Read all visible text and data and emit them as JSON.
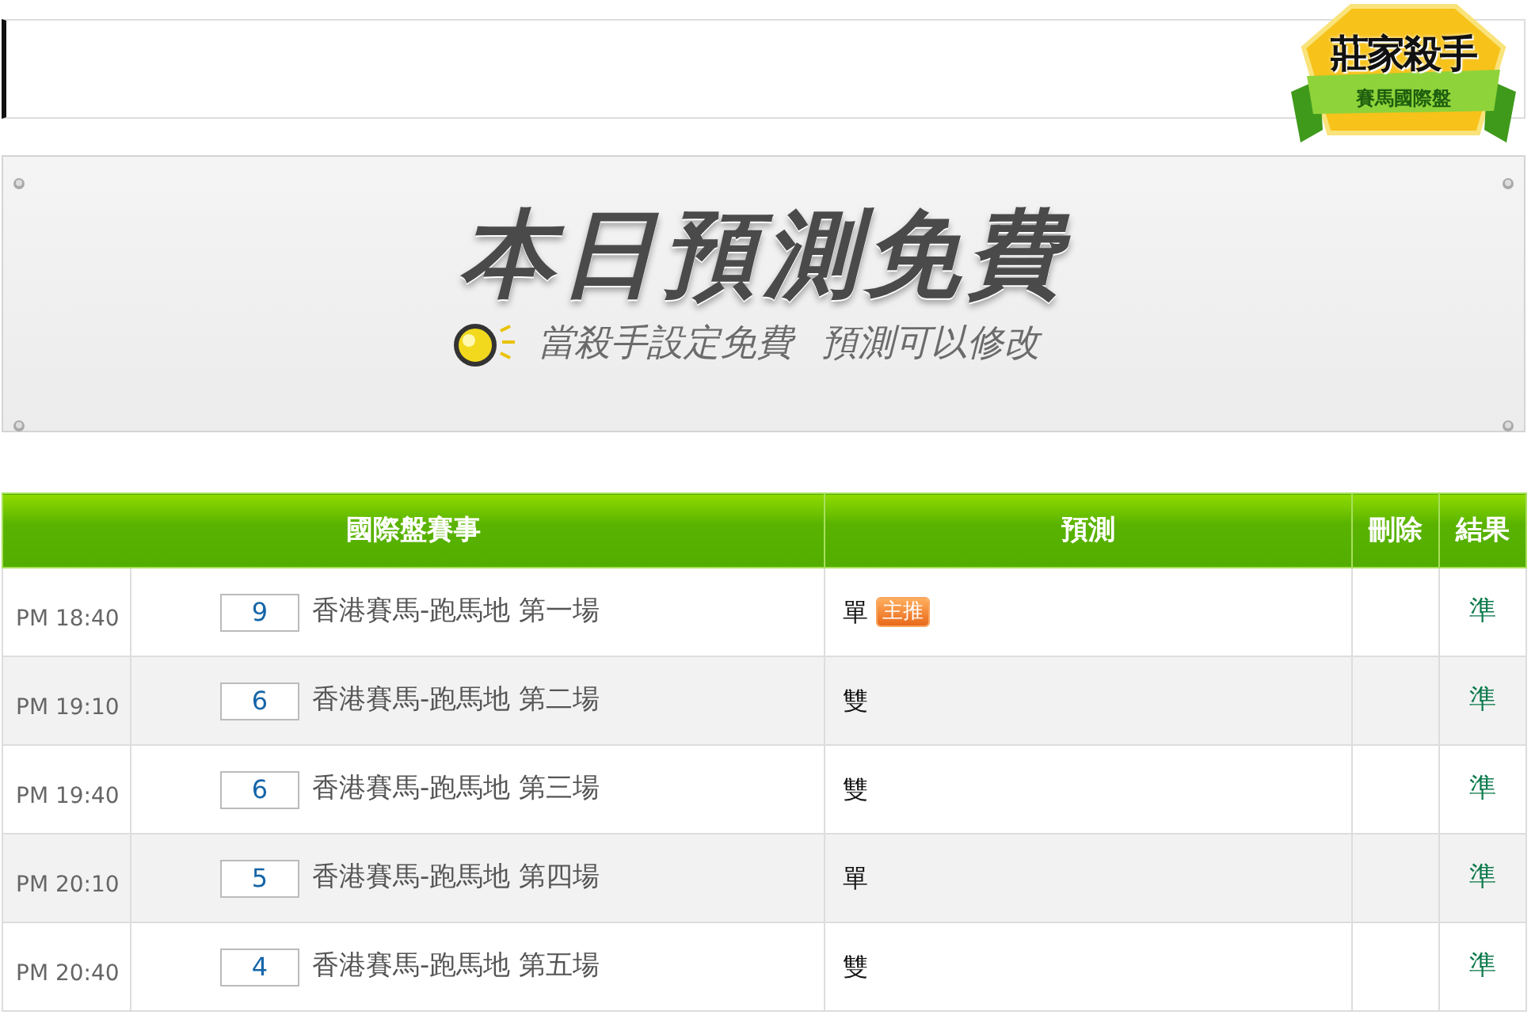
{
  "logo": {
    "title": "莊家殺手",
    "subtitle": "賽馬國際盤"
  },
  "banner": {
    "headline": "本日預測免費",
    "tagline": [
      "當殺手設定免費",
      "預測可以修改"
    ]
  },
  "table": {
    "columns": [
      "國際盤賽事",
      "預測",
      "刪除",
      "結果"
    ],
    "rows": [
      {
        "time": "PM 18:40",
        "number": "9",
        "event": "香港賽馬-跑馬地 第一場",
        "prediction": "單",
        "badge": "主推",
        "result": "準"
      },
      {
        "time": "PM 19:10",
        "number": "6",
        "event": "香港賽馬-跑馬地 第二場",
        "prediction": "雙",
        "result": "準"
      },
      {
        "time": "PM 19:40",
        "number": "6",
        "event": "香港賽馬-跑馬地 第三場",
        "prediction": "雙",
        "result": "準"
      },
      {
        "time": "PM 20:10",
        "number": "5",
        "event": "香港賽馬-跑馬地 第四場",
        "prediction": "單",
        "result": "準"
      },
      {
        "time": "PM 20:40",
        "number": "4",
        "event": "香港賽馬-跑馬地 第五場",
        "prediction": "雙",
        "result": "準"
      }
    ]
  }
}
